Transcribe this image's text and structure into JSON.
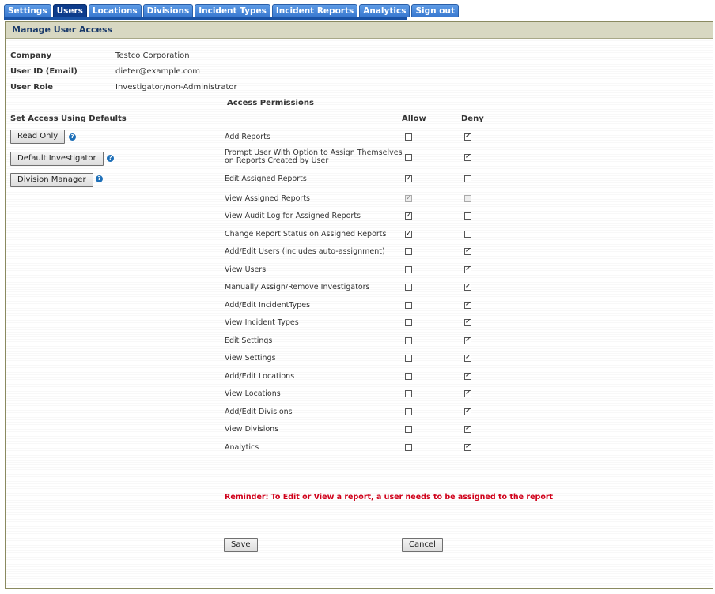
{
  "nav": {
    "tabs": [
      {
        "label": "Settings",
        "active": false
      },
      {
        "label": "Users",
        "active": true
      },
      {
        "label": "Locations",
        "active": false
      },
      {
        "label": "Divisions",
        "active": false
      },
      {
        "label": "Incident Types",
        "active": false
      },
      {
        "label": "Incident Reports",
        "active": false
      },
      {
        "label": "Analytics",
        "active": false
      },
      {
        "label": "Sign out",
        "active": false
      }
    ]
  },
  "header": {
    "title": "Manage User Access"
  },
  "user": {
    "company_label": "Company",
    "company": "Testco Corporation",
    "userid_label": "User ID (Email)",
    "userid": "dieter@example.com",
    "role_label": "User Role",
    "role": "Investigator/non-Administrator"
  },
  "permissions_heading": "Access Permissions",
  "defaults": {
    "heading": "Set Access Using Defaults",
    "buttons": [
      "Read Only",
      "Default Investigator",
      "Division Manager"
    ],
    "help_glyph": "?"
  },
  "columns": {
    "allow": "Allow",
    "deny": "Deny"
  },
  "permissions": [
    {
      "label": "Add Reports",
      "allow": false,
      "deny": true,
      "disabled": false
    },
    {
      "label": "Prompt User With Option to Assign Themselves on Reports Created by User",
      "allow": false,
      "deny": true,
      "disabled": false
    },
    {
      "label": "Edit Assigned Reports",
      "allow": true,
      "deny": false,
      "disabled": false
    },
    {
      "label": "View Assigned Reports",
      "allow": true,
      "deny": false,
      "disabled": true
    },
    {
      "label": "View Audit Log for Assigned Reports",
      "allow": true,
      "deny": false,
      "disabled": false
    },
    {
      "label": "Change Report Status on Assigned Reports",
      "allow": true,
      "deny": false,
      "disabled": false
    },
    {
      "label": "Add/Edit Users (includes auto-assignment)",
      "allow": false,
      "deny": true,
      "disabled": false
    },
    {
      "label": "View Users",
      "allow": false,
      "deny": true,
      "disabled": false
    },
    {
      "label": "Manually Assign/Remove Investigators",
      "allow": false,
      "deny": true,
      "disabled": false
    },
    {
      "label": "Add/Edit IncidentTypes",
      "allow": false,
      "deny": true,
      "disabled": false
    },
    {
      "label": "View Incident Types",
      "allow": false,
      "deny": true,
      "disabled": false
    },
    {
      "label": "Edit Settings",
      "allow": false,
      "deny": true,
      "disabled": false
    },
    {
      "label": "View Settings",
      "allow": false,
      "deny": true,
      "disabled": false
    },
    {
      "label": "Add/Edit Locations",
      "allow": false,
      "deny": true,
      "disabled": false
    },
    {
      "label": "View Locations",
      "allow": false,
      "deny": true,
      "disabled": false
    },
    {
      "label": "Add/Edit Divisions",
      "allow": false,
      "deny": true,
      "disabled": false
    },
    {
      "label": "View Divisions",
      "allow": false,
      "deny": true,
      "disabled": false
    },
    {
      "label": "Analytics",
      "allow": false,
      "deny": true,
      "disabled": false
    }
  ],
  "reminder": "Reminder: To Edit or View a report, a user needs to be assigned to the report",
  "actions": {
    "save": "Save",
    "cancel": "Cancel"
  },
  "check_glyph": "✓"
}
